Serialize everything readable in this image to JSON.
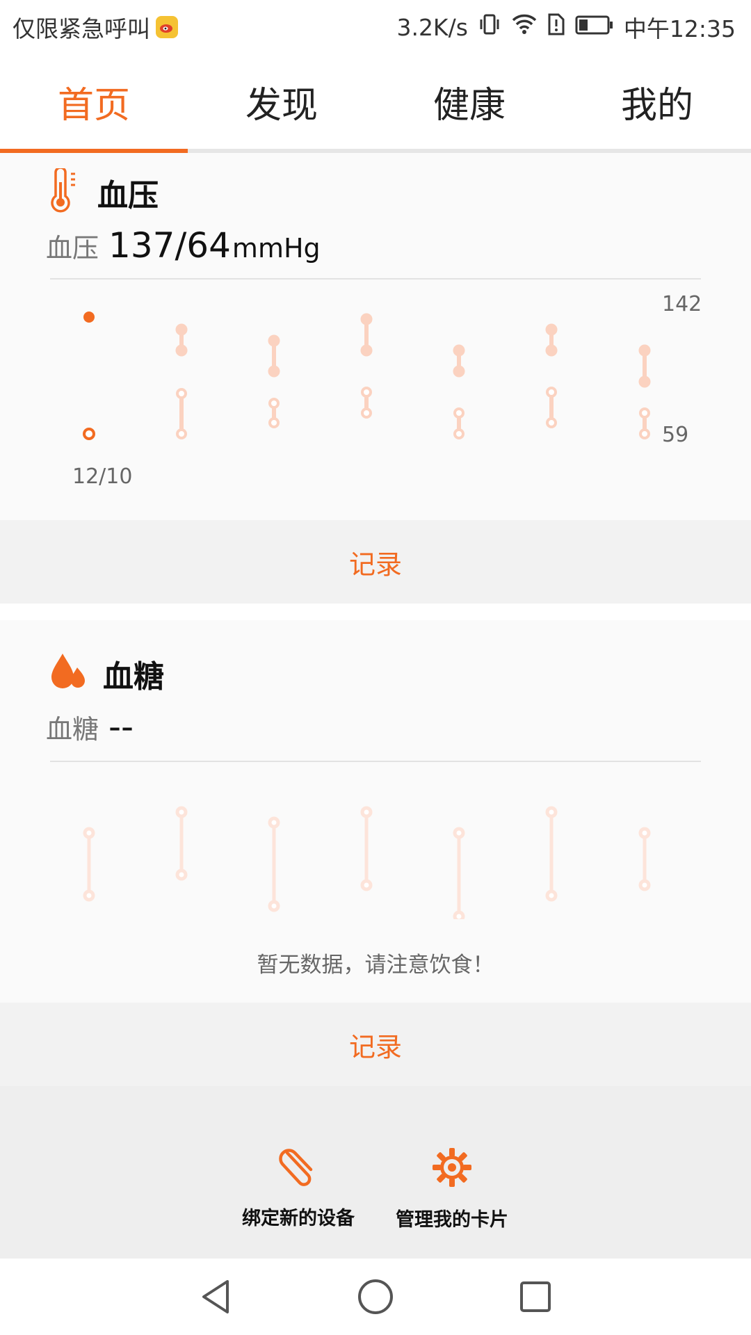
{
  "status_bar": {
    "carrier_text": "仅限紧急呼叫",
    "net_speed": "3.2K/s",
    "time": "中午12:35",
    "icons": [
      "weibo-icon",
      "vibrate-icon",
      "wifi-icon",
      "sim-alert-icon",
      "battery-icon"
    ]
  },
  "tabs": [
    {
      "label": "首页",
      "active": true
    },
    {
      "label": "发现",
      "active": false
    },
    {
      "label": "健康",
      "active": false
    },
    {
      "label": "我的",
      "active": false
    }
  ],
  "bp_card": {
    "title": "血压",
    "icon": "thermometer-icon",
    "metric_label": "血压",
    "metric_value": "137/64",
    "metric_unit": "mmHg",
    "y_max_label": "142",
    "y_min_label": "59",
    "first_date": "12/10",
    "record_label": "记录"
  },
  "bs_card": {
    "title": "血糖",
    "icon": "drops-icon",
    "metric_label": "血糖",
    "metric_value": "--",
    "empty_note": "暂无数据，请注意饮食！",
    "record_label": "记录"
  },
  "footer_actions": [
    {
      "label": "绑定新的设备",
      "icon": "paperclip-icon"
    },
    {
      "label": "管理我的卡片",
      "icon": "gear-icon"
    }
  ],
  "colors": {
    "accent": "#f26b21",
    "faded": "#fbd2c0",
    "faded_light": "#fde4da"
  }
}
